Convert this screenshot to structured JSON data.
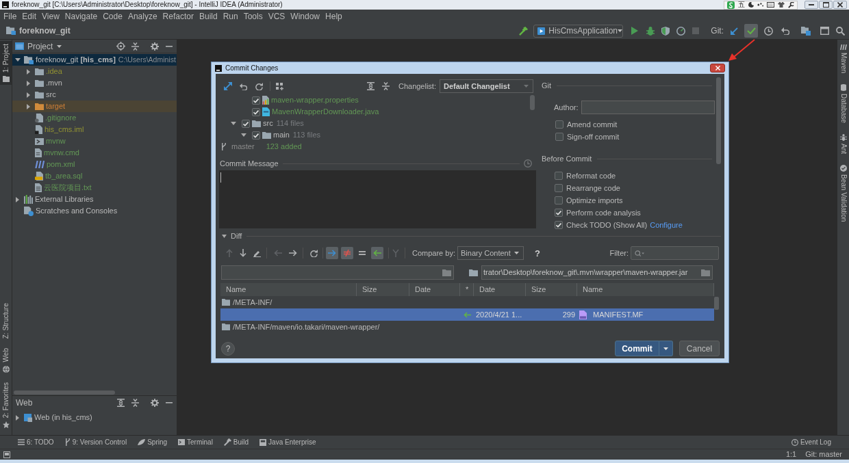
{
  "window": {
    "title": "foreknow_git [C:\\Users\\Administrator\\Desktop\\foreknow_git] - IntelliJ IDEA (Administrator)",
    "input_mode": "五"
  },
  "menu": [
    "File",
    "Edit",
    "View",
    "Navigate",
    "Code",
    "Analyze",
    "Refactor",
    "Build",
    "Run",
    "Tools",
    "VCS",
    "Window",
    "Help"
  ],
  "navbar": {
    "project": "foreknow_git",
    "run_config": "HisCmsApplication",
    "vcs_label": "Git:",
    "vcs_actions": [
      {
        "kind": "update",
        "highlighted": false
      },
      {
        "kind": "commit",
        "highlighted": true
      },
      {
        "kind": "history",
        "highlighted": false
      },
      {
        "kind": "rollback",
        "highlighted": false
      }
    ]
  },
  "left_stripe": {
    "top": [
      {
        "label": "1: Project",
        "kind": "project",
        "selected": true
      }
    ],
    "bottom": [
      {
        "label": "Z: Structure",
        "kind": "structure",
        "selected": false
      },
      {
        "label": "Web",
        "kind": "web",
        "selected": false
      },
      {
        "label": "2: Favorites",
        "kind": "favorites",
        "selected": false
      }
    ]
  },
  "project_panel": {
    "title": "Project",
    "tree": [
      {
        "label": "foreknow_git **[his_cms]**",
        "path": "C:\\Users\\Administ",
        "kind": "module",
        "excluded": false,
        "expanded": true,
        "selected": true,
        "children": [
          {
            "label": ".idea",
            "kind": "folder",
            "color": "#939332",
            "excluded": false,
            "expanded": false,
            "selected": false
          },
          {
            "label": ".mvn",
            "kind": "folder",
            "excluded": false,
            "expanded": false,
            "selected": false
          },
          {
            "label": "src",
            "kind": "folder",
            "excluded": false,
            "expanded": false,
            "selected": false
          },
          {
            "label": "target",
            "kind": "folder",
            "color": "#cf7f36",
            "excluded": true,
            "expanded": false,
            "selected": false
          },
          {
            "label": ".gitignore",
            "kind": "ignore_file",
            "color": "#629755",
            "excluded": false,
            "selected": false
          },
          {
            "label": "his_cms.iml",
            "kind": "iml_file",
            "color": "#939332",
            "excluded": false,
            "selected": false
          },
          {
            "label": "mvnw",
            "kind": "script_file",
            "color": "#629755",
            "excluded": false,
            "selected": false
          },
          {
            "label": "mvnw.cmd",
            "kind": "cmd_file",
            "color": "#629755",
            "excluded": false,
            "selected": false
          },
          {
            "label": "pom.xml",
            "kind": "maven_file",
            "color": "#629755",
            "excluded": false,
            "selected": false
          },
          {
            "label": "tb_area.sql",
            "kind": "sql_file",
            "color": "#629755",
            "excluded": false,
            "selected": false
          },
          {
            "label": "云医院项目.txt",
            "kind": "text_file",
            "color": "#629755",
            "excluded": false,
            "selected": false
          }
        ]
      },
      {
        "label": "External Libraries",
        "kind": "libraries",
        "excluded": false,
        "expanded": false,
        "selected": false
      },
      {
        "label": "Scratches and Consoles",
        "kind": "scratches",
        "excluded": false,
        "selected": false
      }
    ]
  },
  "web_panel": {
    "title": "Web",
    "tree": [
      {
        "label": "Web (in his_cms)",
        "kind": "web",
        "expanded": false,
        "selected": false
      }
    ]
  },
  "right_stripe": [
    {
      "label": "Maven",
      "kind": "maven"
    },
    {
      "label": "Database",
      "kind": "database"
    },
    {
      "label": "Ant",
      "kind": "ant"
    },
    {
      "label": "Bean Validation",
      "kind": "bean_validation"
    }
  ],
  "dialog": {
    "title": "Commit Changes",
    "changelist_label": "Changelist:",
    "changelist": "Default Changelist",
    "changes_tree": [
      {
        "children": [
          {
            "label": "maven-wrapper.properties",
            "kind": "properties",
            "color": "#629755",
            "checked": true
          },
          {
            "label": "MavenWrapperDownloader.java",
            "kind": "java",
            "color": "#629755",
            "checked": true
          }
        ]
      },
      {
        "label": "src",
        "kind": "folder",
        "count": "114 files",
        "checked": true,
        "expanded": true,
        "children": [
          {
            "label": "main",
            "kind": "folder",
            "count": "113 files",
            "checked": true,
            "expanded": true
          }
        ]
      }
    ],
    "branch": "master",
    "summary": "123 added",
    "message_label": "Commit Message",
    "git_section": {
      "title": "Git",
      "author_label": "Author:",
      "options": [
        {
          "label": "Amend commit",
          "checked": false
        },
        {
          "label": "Sign-off commit",
          "checked": false
        }
      ]
    },
    "before_commit": {
      "title": "Before Commit",
      "options": [
        {
          "label": "Reformat code",
          "checked": false
        },
        {
          "label": "Rearrange code",
          "checked": false
        },
        {
          "label": "Optimize imports",
          "checked": false
        },
        {
          "label": "Perform code analysis",
          "checked": true
        },
        {
          "label": "Check TODO (Show All)",
          "checked": true,
          "link": "Configure"
        }
      ]
    },
    "diff": {
      "title": "Diff",
      "expanded": true,
      "toolbar": [
        {
          "kind": "up",
          "disabled": true
        },
        {
          "kind": "down",
          "disabled": false
        },
        {
          "kind": "edit",
          "disabled": false
        },
        {
          "kind": "left",
          "disabled": true
        },
        {
          "kind": "right",
          "disabled": false
        },
        {
          "kind": "refresh",
          "disabled": false
        }
      ],
      "filters": [
        {
          "kind": "left_only",
          "pressed": true
        },
        {
          "kind": "different",
          "pressed": true
        },
        {
          "kind": "equal",
          "pressed": false
        },
        {
          "kind": "right_only",
          "pressed": true
        }
      ],
      "merge": {
        "disabled": true
      },
      "compare_label": "Compare by:",
      "compare_value": "Binary Content",
      "help": "?",
      "filter_label": "Filter:",
      "right_path": "trator\\Desktop\\foreknow_git\\.mvn\\wrapper\\maven-wrapper.jar",
      "columns": [
        "Name",
        "Size",
        "Date",
        "*",
        "Date",
        "Size",
        "Name"
      ],
      "rows": [
        {
          "kind": "folder",
          "path": "/META-INF/",
          "selected": false
        },
        {
          "kind": "right_only",
          "right_date": "2020/4/21 1...",
          "right_size": "299",
          "right_name": "MANIFEST.MF",
          "selected": true
        },
        {
          "kind": "folder",
          "path": "/META-INF/maven/io.takari/maven-wrapper/",
          "selected": false
        }
      ]
    },
    "help_button": "?",
    "buttons": [
      {
        "label": "Commit",
        "kind": "primary"
      },
      {
        "label": "Cancel",
        "kind": "secondary"
      }
    ]
  },
  "bottom_tools": [
    {
      "label": "6: TODO",
      "kind": "todo"
    },
    {
      "label": "9: Version Control",
      "kind": "vcs"
    },
    {
      "label": "Spring",
      "kind": "spring"
    },
    {
      "label": "Terminal",
      "kind": "terminal"
    },
    {
      "label": "Build",
      "kind": "build"
    },
    {
      "label": "Java Enterprise",
      "kind": "java_enterprise"
    }
  ],
  "event_log": "Event Log",
  "status_bar": {
    "position": "1:1",
    "branch": "Git: master"
  }
}
